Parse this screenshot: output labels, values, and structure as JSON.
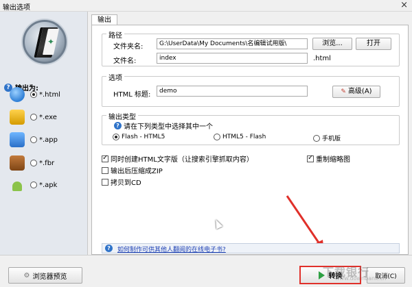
{
  "window": {
    "title": "输出选项",
    "close_symbol": "×"
  },
  "sidebar": {
    "output_label": "输出为:",
    "formats": [
      {
        "label": "*.html",
        "icon": "globe-icon",
        "checked": true
      },
      {
        "label": "*.exe",
        "icon": "exe-icon",
        "checked": false
      },
      {
        "label": "*.app",
        "icon": "mac-finder-icon",
        "checked": false
      },
      {
        "label": "*.fbr",
        "icon": "book-icon",
        "checked": false
      },
      {
        "label": "*.apk",
        "icon": "android-icon",
        "checked": false
      }
    ]
  },
  "tabs": [
    {
      "label": "输出",
      "active": true
    }
  ],
  "path_group": {
    "title": "路径",
    "folder_label": "文件夹名:",
    "folder_value": "G:\\UserData\\My Documents\\名编辑试用版\\",
    "browse_button": "浏览...",
    "open_button": "打开",
    "filename_label": "文件名:",
    "filename_value": "index",
    "extension": ".html"
  },
  "options_group": {
    "title": "选项",
    "html_title_label": "HTML 标题:",
    "html_title_value": "demo",
    "advanced_button": "高级(A)"
  },
  "output_type_group": {
    "title": "输出类型",
    "hint": "请在下列类型中选择其中一个",
    "types": [
      {
        "label": "Flash - HTML5",
        "checked": true
      },
      {
        "label": "HTML5 - Flash",
        "checked": false
      },
      {
        "label": "手机版",
        "checked": false
      }
    ]
  },
  "checkboxes": {
    "create_text_version": {
      "label": "同时创建HTML文字版（让搜索引擎抓取内容）",
      "checked": true
    },
    "redraw_thumbnails": {
      "label": "重制缩略图",
      "checked": true
    },
    "zip_after_output": {
      "label": "输出后压缩成ZIP",
      "checked": false
    },
    "burn_to_cd": {
      "label": "拷贝到CD",
      "checked": false
    }
  },
  "help_link": "如何制作可供其他人翻阅的在线电子书?",
  "footer": {
    "browser_preview_button": "浏览器预览",
    "convert_button": "转换",
    "cancel_button": "取消(C)"
  },
  "watermark": {
    "text": "下载银行",
    "sub": "www.downbank.cn"
  },
  "colors": {
    "highlight_red": "#e0302a",
    "link_blue": "#1c3fb3",
    "play_green": "#2ea043"
  }
}
